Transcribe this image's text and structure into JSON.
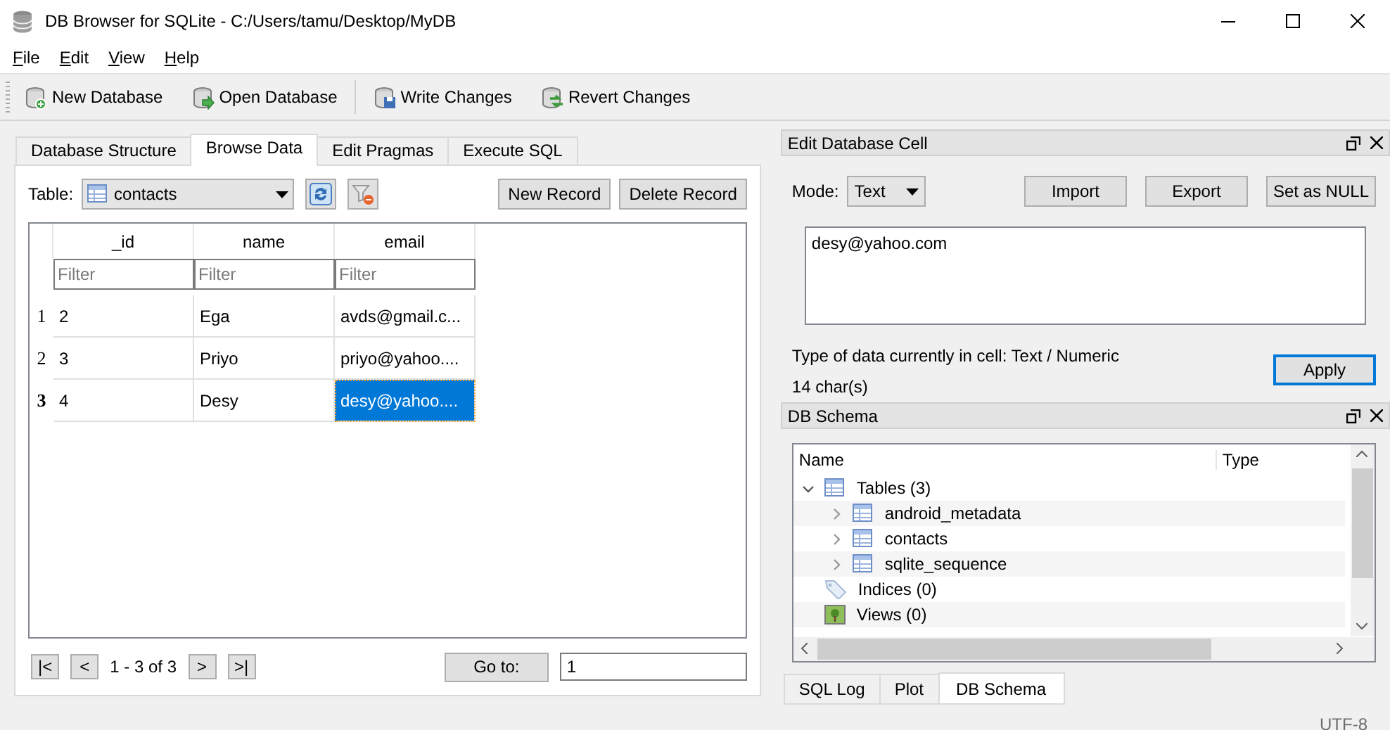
{
  "window": {
    "title": "DB Browser for SQLite - C:/Users/tamu/Desktop/MyDB"
  },
  "menu": [
    {
      "label": "File"
    },
    {
      "label": "Edit"
    },
    {
      "label": "View"
    },
    {
      "label": "Help"
    }
  ],
  "toolbar": [
    {
      "label": "New Database",
      "kind": "new",
      "separator_before": false
    },
    {
      "label": "Open Database",
      "kind": "open",
      "separator_before": false
    },
    {
      "label": "Write Changes",
      "kind": "write",
      "separator_before": true
    },
    {
      "label": "Revert Changes",
      "kind": "revert",
      "separator_before": false
    }
  ],
  "tabs": [
    {
      "label": "Database Structure",
      "selected": false
    },
    {
      "label": "Browse Data",
      "selected": true
    },
    {
      "label": "Edit Pragmas",
      "selected": false
    },
    {
      "label": "Execute SQL",
      "selected": false
    }
  ],
  "browse": {
    "table_label": "Table:",
    "table": "contacts",
    "buttons": [
      "New Record",
      "Delete Record"
    ],
    "columns": [
      {
        "name": "_id",
        "filter_placeholder": "Filter"
      },
      {
        "name": "name",
        "filter_placeholder": "Filter"
      },
      {
        "name": "email",
        "filter_placeholder": "Filter"
      }
    ],
    "rows": [
      {
        "number": "1",
        "selected": false,
        "cells": [
          {
            "text": "2",
            "selected": false
          },
          {
            "text": "Ega",
            "selected": false
          },
          {
            "text": "avds@gmail.c...",
            "selected": false
          }
        ]
      },
      {
        "number": "2",
        "selected": false,
        "cells": [
          {
            "text": "3",
            "selected": false
          },
          {
            "text": "Priyo",
            "selected": false
          },
          {
            "text": "priyo@yahoo....",
            "selected": false
          }
        ]
      },
      {
        "number": "3",
        "selected": true,
        "cells": [
          {
            "text": "4",
            "selected": false
          },
          {
            "text": "Desy",
            "selected": false
          },
          {
            "text": "desy@yahoo....",
            "selected": true
          }
        ]
      }
    ],
    "pager": {
      "first": "|<",
      "prev": "<",
      "range": "1 - 3 of 3",
      "next": ">",
      "last": ">|",
      "goto_button": "Go to:",
      "goto_value": "1"
    }
  },
  "edit_cell": {
    "title": "Edit Database Cell",
    "mode_label": "Mode:",
    "mode": "Text",
    "buttons": [
      "Import",
      "Export",
      "Set as NULL"
    ],
    "value": "desy@yahoo.com",
    "type_info": "Type of data currently in cell: Text / Numeric",
    "size_info": "14 char(s)",
    "apply": "Apply"
  },
  "schema": {
    "title": "DB Schema",
    "columns": [
      "Name",
      "Type"
    ],
    "tree": [
      {
        "label": "Tables (3)",
        "kind": "tables",
        "expanded": true,
        "children": [
          {
            "label": "android_metadata",
            "kind": "table",
            "expanded": false
          },
          {
            "label": "contacts",
            "kind": "table",
            "expanded": false
          },
          {
            "label": "sqlite_sequence",
            "kind": "table",
            "expanded": false
          }
        ]
      },
      {
        "label": "Indices (0)",
        "kind": "indices"
      },
      {
        "label": "Views (0)",
        "kind": "views"
      }
    ]
  },
  "dock_tabs": [
    {
      "label": "SQL Log",
      "selected": false
    },
    {
      "label": "Plot",
      "selected": false
    },
    {
      "label": "DB Schema",
      "selected": true
    }
  ],
  "status_bar": {
    "encoding": "UTF-8"
  }
}
